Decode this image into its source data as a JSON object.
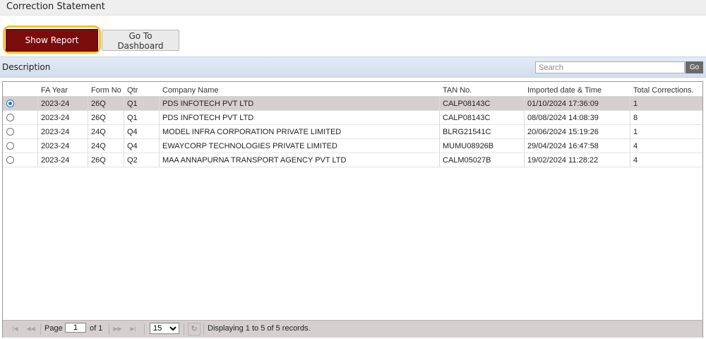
{
  "page_title": "Correction Statement",
  "buttons": {
    "show_report": "Show Report",
    "go_to_dashboard": "Go To Dashboard"
  },
  "description_label": "Description",
  "search": {
    "placeholder": "Search",
    "go_label": "Go"
  },
  "table": {
    "columns": [
      "FA Year",
      "Form No",
      "Qtr",
      "Company Name",
      "TAN No.",
      "Imported date & Time",
      "Total Corrections."
    ],
    "rows": [
      {
        "selected": true,
        "fa_year": "2023-24",
        "form_no": "26Q",
        "qtr": "Q1",
        "company": "PDS INFOTECH PVT LTD",
        "tan": "CALP08143C",
        "imported": "01/10/2024 17:36:09",
        "total": "1"
      },
      {
        "selected": false,
        "fa_year": "2023-24",
        "form_no": "26Q",
        "qtr": "Q1",
        "company": "PDS INFOTECH PVT LTD",
        "tan": "CALP08143C",
        "imported": "08/08/2024 14:08:39",
        "total": "8"
      },
      {
        "selected": false,
        "fa_year": "2023-24",
        "form_no": "24Q",
        "qtr": "Q4",
        "company": "MODEL INFRA CORPORATION PRIVATE LIMITED",
        "tan": "BLRG21541C",
        "imported": "20/06/2024 15:19:26",
        "total": "1"
      },
      {
        "selected": false,
        "fa_year": "2023-24",
        "form_no": "24Q",
        "qtr": "Q4",
        "company": "EWAYCORP TECHNOLOGIES PRIVATE LIMITED",
        "tan": "MUMU08926B",
        "imported": "29/04/2024 16:47:58",
        "total": "4"
      },
      {
        "selected": false,
        "fa_year": "2023-24",
        "form_no": "26Q",
        "qtr": "Q2",
        "company": "MAA ANNAPURNA TRANSPORT AGENCY PVT LTD",
        "tan": "CALM05027B",
        "imported": "19/02/2024 11:28:22",
        "total": "4"
      }
    ]
  },
  "pager": {
    "page_label": "Page",
    "current_page": "1",
    "of_label": "of 1",
    "page_size": "15",
    "page_size_options": [
      "15"
    ],
    "display_text": "Displaying 1 to 5 of 5 records."
  },
  "colors": {
    "primary_button": "#7b0c0c",
    "highlight_outline": "#f5c229",
    "selected_row": "#d5cfcf",
    "header_bar": "#dfe7f3"
  }
}
